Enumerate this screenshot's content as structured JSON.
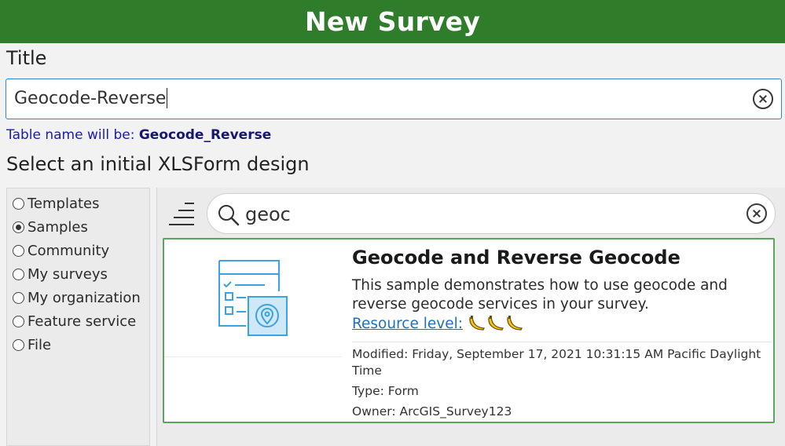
{
  "window": {
    "title": "New Survey"
  },
  "title_field": {
    "label": "Title",
    "value": "Geocode-Reverse"
  },
  "table_name": {
    "prefix": "Table name will be: ",
    "value": "Geocode_Reverse"
  },
  "design": {
    "label": "Select an initial XLSForm design",
    "sources": [
      {
        "label": "Templates",
        "checked": false
      },
      {
        "label": "Samples",
        "checked": true
      },
      {
        "label": "Community",
        "checked": false
      },
      {
        "label": "My surveys",
        "checked": false
      },
      {
        "label": "My organization",
        "checked": false
      },
      {
        "label": "Feature service",
        "checked": false
      },
      {
        "label": "File",
        "checked": false
      }
    ]
  },
  "search": {
    "value": "geoc",
    "icon": "search-icon"
  },
  "result": {
    "title": "Geocode and Reverse Geocode",
    "description": "This sample demonstrates how to use geocode and reverse geocode services in your survey.",
    "resource_label": "Resource level:",
    "resource_level_count": 3,
    "modified": "Modified: Friday, September 17, 2021 10:31:15 AM Pacific Daylight Time",
    "type": "Type: Form",
    "owner": "Owner: ArcGIS_Survey123"
  },
  "colors": {
    "header_green": "#2f7d2a",
    "focus_blue": "#2c86d2",
    "selected_card_border": "#5aa55b",
    "link_blue": "#1f6fbf",
    "thumbnail_blue": "#3aa3e0"
  }
}
